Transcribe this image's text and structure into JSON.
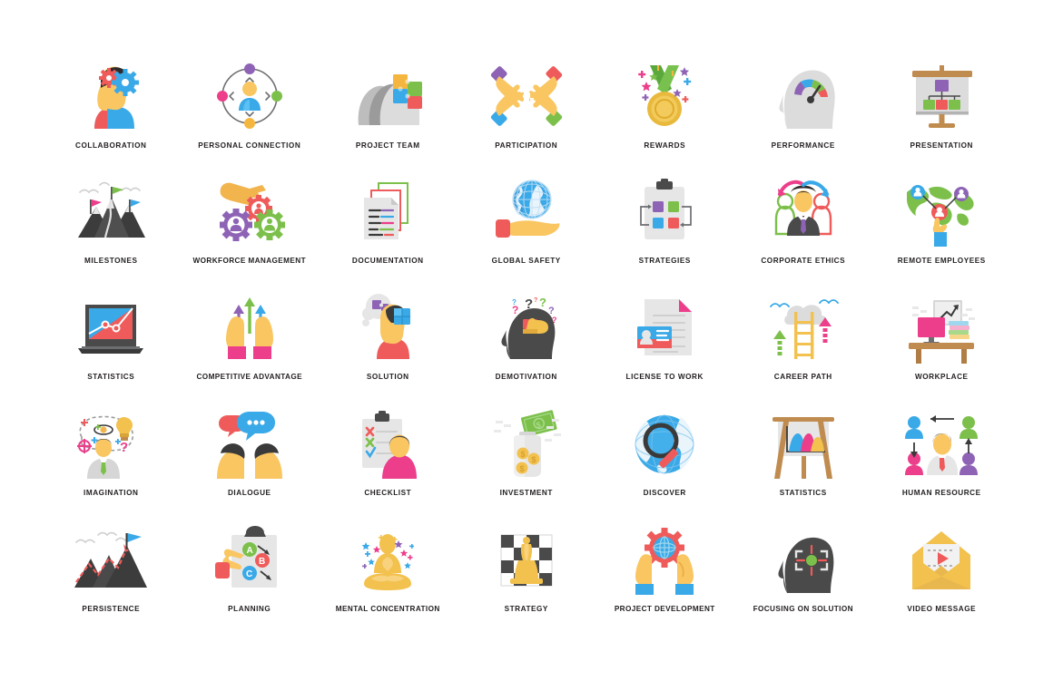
{
  "sheet": {
    "background": "#ffffff",
    "columns": 7,
    "rows": 5,
    "total_icons": 35,
    "caption_color": "#231f20"
  },
  "palette": {
    "yellow_skin": "#f9c662",
    "skin": "#f7d08a",
    "blue": "#3aa9e8",
    "light_blue": "#5bc0f3",
    "red": "#ef5b5b",
    "pink": "#ec3e8a",
    "hot_pink": "#f0468d",
    "green": "#7cc04b",
    "purple": "#8e63b5",
    "dark_gray": "#4a4a4a",
    "mid_gray": "#9b9b9b",
    "light_gray": "#e3e3e3",
    "wood": "#c08b4f",
    "gold": "#e3b23c",
    "teal": "#35c4d7"
  },
  "icons": [
    {
      "label": "COLLABORATION",
      "icon": "head-with-gears-icon",
      "row": 1,
      "col": 1
    },
    {
      "label": "PERSONAL CONNECTION",
      "icon": "person-orbit-network-icon",
      "row": 1,
      "col": 2
    },
    {
      "label": "PROJECT TEAM",
      "icon": "heads-puzzle-icon",
      "row": 1,
      "col": 3
    },
    {
      "label": "PARTICIPATION",
      "icon": "four-hands-puzzle-icon",
      "row": 1,
      "col": 4
    },
    {
      "label": "REWARDS",
      "icon": "gold-medal-icon",
      "row": 1,
      "col": 5
    },
    {
      "label": "PERFORMANCE",
      "icon": "head-gauge-icon",
      "row": 1,
      "col": 6
    },
    {
      "label": "PRESENTATION",
      "icon": "presentation-board-org-chart-icon",
      "row": 1,
      "col": 7
    },
    {
      "label": "MILESTONES",
      "icon": "mountains-flags-icon",
      "row": 2,
      "col": 1
    },
    {
      "label": "WORKFORCE MANAGEMENT",
      "icon": "hand-gears-people-icon",
      "row": 2,
      "col": 2
    },
    {
      "label": "DOCUMENTATION",
      "icon": "stacked-documents-icon",
      "row": 2,
      "col": 3
    },
    {
      "label": "GLOBAL SAFETY",
      "icon": "hand-holding-globe-icon",
      "row": 2,
      "col": 4
    },
    {
      "label": "STRATEGIES",
      "icon": "clipboard-flow-squares-icon",
      "row": 2,
      "col": 5
    },
    {
      "label": "CORPORATE ETHICS",
      "icon": "businessman-exchange-arrows-icon",
      "row": 2,
      "col": 6
    },
    {
      "label": "REMOTE EMPLOYEES",
      "icon": "world-map-avatars-icon",
      "row": 2,
      "col": 7
    },
    {
      "label": "STATISTICS",
      "icon": "laptop-chart-icon",
      "row": 3,
      "col": 1
    },
    {
      "label": "COMPETITIVE ADVANTAGE",
      "icon": "hands-up-arrows-icon",
      "row": 3,
      "col": 2
    },
    {
      "label": "SOLUTION",
      "icon": "head-puzzle-thought-icon",
      "row": 3,
      "col": 3
    },
    {
      "label": "DEMOTIVATION",
      "icon": "head-thumbs-down-questions-icon",
      "row": 3,
      "col": 4
    },
    {
      "label": "LICENSE TO WORK",
      "icon": "document-id-card-icon",
      "row": 3,
      "col": 5
    },
    {
      "label": "CAREER PATH",
      "icon": "ladder-cloud-arrows-icon",
      "row": 3,
      "col": 6
    },
    {
      "label": "WORKPLACE",
      "icon": "desk-monitor-books-icon",
      "row": 3,
      "col": 7
    },
    {
      "label": "IMAGINATION",
      "icon": "person-lightbulb-ideas-icon",
      "row": 4,
      "col": 1
    },
    {
      "label": "DIALOGUE",
      "icon": "two-heads-speech-bubbles-icon",
      "row": 4,
      "col": 2
    },
    {
      "label": "CHECKLIST",
      "icon": "clipboard-person-checks-icon",
      "row": 4,
      "col": 3
    },
    {
      "label": "INVESTMENT",
      "icon": "money-jar-coins-icon",
      "row": 4,
      "col": 4
    },
    {
      "label": "DISCOVER",
      "icon": "globe-magnifier-icon",
      "row": 4,
      "col": 5
    },
    {
      "label": "STATISTICS",
      "icon": "easel-chart-icon",
      "row": 4,
      "col": 6
    },
    {
      "label": "HUMAN RESOURCE",
      "icon": "avatars-circle-manager-icon",
      "row": 4,
      "col": 7
    },
    {
      "label": "PERSISTENCE",
      "icon": "mountain-flag-path-icon",
      "row": 5,
      "col": 1
    },
    {
      "label": "PLANNING",
      "icon": "clipboard-abc-hand-icon",
      "row": 5,
      "col": 2
    },
    {
      "label": "MENTAL CONCENTRATION",
      "icon": "meditation-lotus-icon",
      "row": 5,
      "col": 3
    },
    {
      "label": "STRATEGY",
      "icon": "chessboard-queen-icon",
      "row": 5,
      "col": 4
    },
    {
      "label": "PROJECT DEVELOPMENT",
      "icon": "hands-gear-globe-icon",
      "row": 5,
      "col": 5
    },
    {
      "label": "FOCUSING ON SOLUTION",
      "icon": "head-target-focus-icon",
      "row": 5,
      "col": 6
    },
    {
      "label": "VIDEO MESSAGE",
      "icon": "envelope-play-icon",
      "row": 5,
      "col": 7
    }
  ]
}
